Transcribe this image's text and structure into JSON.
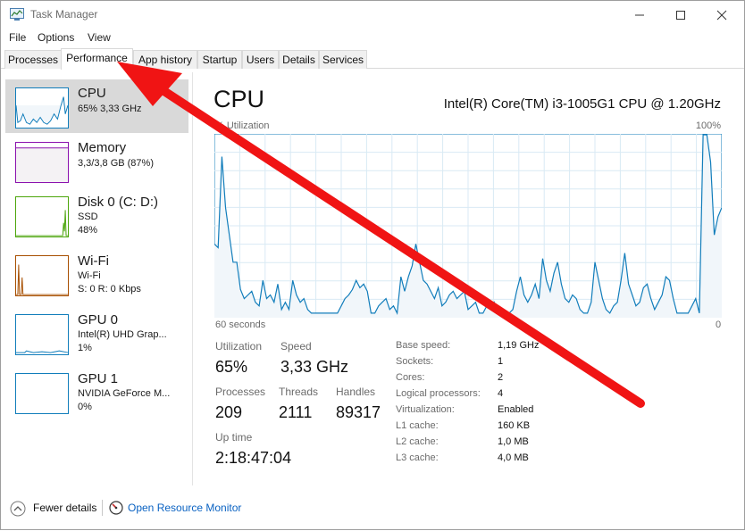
{
  "window": {
    "title": "Task Manager"
  },
  "menu": [
    "File",
    "Options",
    "View"
  ],
  "tabs": [
    "Processes",
    "Performance",
    "App history",
    "Startup",
    "Users",
    "Details",
    "Services"
  ],
  "sidebar": [
    {
      "title": "CPU",
      "lines": [
        "65%  3,33 GHz"
      ],
      "color": "#117dbb"
    },
    {
      "title": "Memory",
      "lines": [
        "3,3/3,8 GB (87%)"
      ],
      "color": "#8b12ae"
    },
    {
      "title": "Disk 0 (C: D:)",
      "lines": [
        "SSD",
        "48%"
      ],
      "color": "#4da60c"
    },
    {
      "title": "Wi-Fi",
      "lines": [
        "Wi-Fi",
        "S: 0  R: 0 Kbps"
      ],
      "color": "#a74f01"
    },
    {
      "title": "GPU 0",
      "lines": [
        "Intel(R) UHD Grap...",
        "1%"
      ],
      "color": "#117dbb"
    },
    {
      "title": "GPU 1",
      "lines": [
        "NVIDIA GeForce M...",
        "0%"
      ],
      "color": "#117dbb"
    }
  ],
  "main": {
    "title": "CPU",
    "cpu_name": "Intel(R) Core(TM) i3-1005G1 CPU @ 1.20GHz",
    "graph": {
      "y_label": "% Utilization",
      "y_max_label": "100%",
      "x_label": "60 seconds",
      "x_min_label": "0",
      "values": [
        40,
        38,
        88,
        60,
        45,
        30,
        30,
        15,
        10,
        12,
        14,
        8,
        6,
        20,
        10,
        12,
        8,
        18,
        4,
        8,
        4,
        20,
        12,
        8,
        10,
        4,
        2,
        2,
        2,
        2,
        2,
        2,
        2,
        2,
        6,
        10,
        12,
        15,
        20,
        16,
        18,
        14,
        2,
        2,
        6,
        8,
        10,
        4,
        6,
        2,
        22,
        14,
        22,
        28,
        40,
        30,
        20,
        18,
        14,
        10,
        16,
        6,
        8,
        12,
        14,
        10,
        12,
        14,
        4,
        6,
        8,
        2,
        2,
        6,
        4,
        8,
        2,
        2,
        2,
        2,
        4,
        14,
        22,
        12,
        8,
        12,
        18,
        10,
        32,
        20,
        14,
        24,
        30,
        18,
        10,
        8,
        12,
        10,
        4,
        2,
        2,
        8,
        30,
        20,
        10,
        4,
        2,
        6,
        8,
        20,
        35,
        18,
        12,
        6,
        8,
        16,
        18,
        10,
        4,
        8,
        12,
        22,
        20,
        10,
        2,
        2,
        2,
        2,
        6,
        10,
        2,
        100,
        100,
        85,
        45,
        55,
        60
      ],
      "stroke": "#117dbb",
      "fill": "#f1f6fa",
      "grid": "#d9eaf4"
    },
    "stats": {
      "utilization_label": "Utilization",
      "utilization": "65%",
      "speed_label": "Speed",
      "speed": "3,33 GHz",
      "processes_label": "Processes",
      "processes": "209",
      "threads_label": "Threads",
      "threads": "2111",
      "handles_label": "Handles",
      "handles": "89317",
      "uptime_label": "Up time",
      "uptime": "2:18:47:04"
    },
    "details": [
      {
        "label": "Base speed:",
        "value": "1,19 GHz"
      },
      {
        "label": "Sockets:",
        "value": "1"
      },
      {
        "label": "Cores:",
        "value": "2"
      },
      {
        "label": "Logical processors:",
        "value": "4"
      },
      {
        "label": "Virtualization:",
        "value": "Enabled"
      },
      {
        "label": "L1 cache:",
        "value": "160 KB"
      },
      {
        "label": "L2 cache:",
        "value": "1,0 MB"
      },
      {
        "label": "L3 cache:",
        "value": "4,0 MB"
      }
    ]
  },
  "footer": {
    "fewer_details": "Fewer details",
    "open_resource_monitor": "Open Resource Monitor"
  },
  "annotation": {
    "arrow_color": "#f01414"
  }
}
